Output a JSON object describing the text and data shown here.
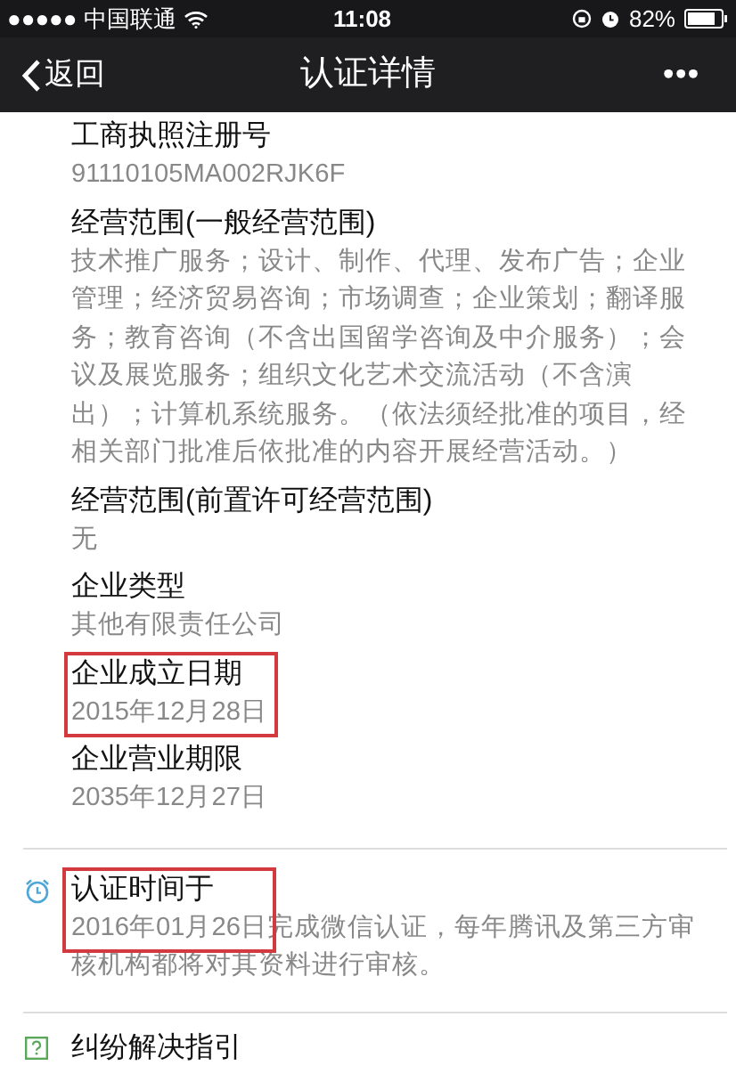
{
  "status_bar": {
    "carrier": "●●●●● 中国联通",
    "time": "11:08",
    "battery": "82%"
  },
  "nav": {
    "back": "返回",
    "title": "认证详情",
    "more": "•••"
  },
  "fields": [
    {
      "label": "工商执照注册号",
      "value": "91110105MA002RJK6F",
      "highlighted": false
    },
    {
      "label": "经营范围(一般经营范围)",
      "value": "技术推广服务；设计、制作、代理、发布广告；企业管理；经济贸易咨询；市场调查；企业策划；翻译服务；教育咨询（不含出国留学咨询及中介服务）；会议及展览服务；组织文化艺术交流活动（不含演出）；计算机系统服务。（依法须经批准的项目，经相关部门批准后依批准的内容开展经营活动。）",
      "highlighted": false
    },
    {
      "label": "经营范围(前置许可经营范围)",
      "value": "无",
      "highlighted": false
    },
    {
      "label": "企业类型",
      "value": "其他有限责任公司",
      "highlighted": false
    },
    {
      "label": "企业成立日期",
      "value": "2015年12月28日",
      "highlighted": true
    },
    {
      "label": "企业营业期限",
      "value": "2035年12月27日",
      "highlighted": false
    }
  ],
  "certification": {
    "label": "认证时间于",
    "text": "2016年01月26日完成微信认证，每年腾讯及第三方审核机构都将对其资料进行审核。",
    "highlighted": true
  },
  "dispute_link": {
    "label": "纠纷解决指引"
  }
}
